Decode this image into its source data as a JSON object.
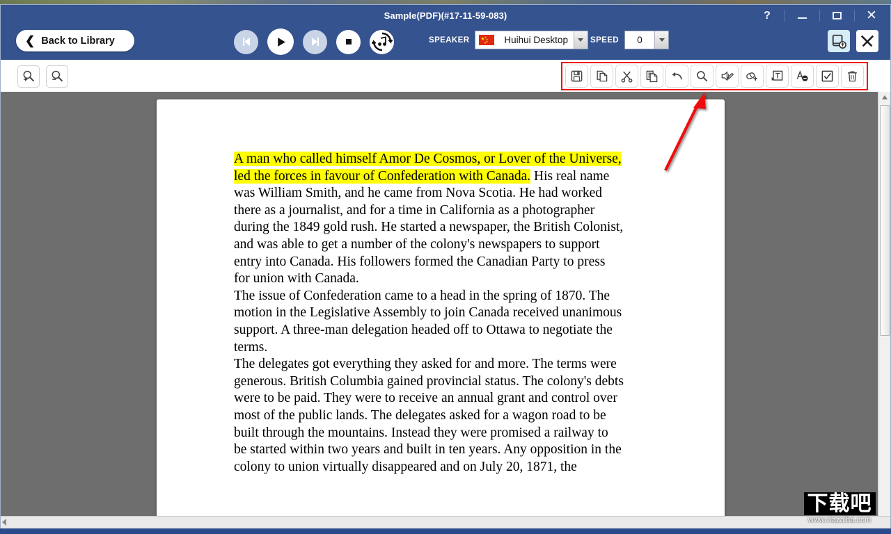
{
  "window": {
    "title": "Sample(PDF)(#17-11-59-083)",
    "controls": [
      {
        "name": "help",
        "label": "?"
      },
      {
        "name": "minimize",
        "label": "—"
      },
      {
        "name": "maximize",
        "label": "❐"
      },
      {
        "name": "close",
        "label": "✕"
      }
    ]
  },
  "toolbar": {
    "back_label": "Back to Library",
    "back_chevron": "❮",
    "transport": [
      {
        "name": "previous-button",
        "icon": "skip-back-icon",
        "state": "disabled"
      },
      {
        "name": "play-button",
        "icon": "play-icon",
        "state": "enabled"
      },
      {
        "name": "next-button",
        "icon": "skip-forward-icon",
        "state": "disabled"
      },
      {
        "name": "stop-button",
        "icon": "stop-icon",
        "state": "enabled"
      },
      {
        "name": "repeat-button",
        "icon": "repeat-music-icon",
        "state": "enabled"
      }
    ],
    "speaker_label": "SPEAKER",
    "speaker_value": "Huihui Desktop",
    "speed_label": "SPEED",
    "speed_value": "0",
    "right_buttons": [
      {
        "name": "send-to-device-button",
        "icon": "device-upload-icon",
        "selected": true
      },
      {
        "name": "settings-tools-button",
        "icon": "tools-icon",
        "selected": false
      }
    ]
  },
  "edit_toolbar": {
    "zoom_buttons": [
      {
        "name": "zoom-in-button",
        "icon": "magnifier-plus-icon"
      },
      {
        "name": "zoom-out-button",
        "icon": "magnifier-minus-icon"
      }
    ],
    "highlight_color": "#ee1111",
    "buttons": [
      {
        "name": "save-button",
        "icon": "floppy-save-icon"
      },
      {
        "name": "copy-pages-button",
        "icon": "copy-pages-icon"
      },
      {
        "name": "cut-button",
        "icon": "scissors-icon"
      },
      {
        "name": "duplicate-button",
        "icon": "document-copy-icon"
      },
      {
        "name": "undo-button",
        "icon": "undo-arrow-icon"
      },
      {
        "name": "find-button",
        "icon": "magnifier-icon"
      },
      {
        "name": "edit-pronunciation-button",
        "icon": "speaker-pencil-icon"
      },
      {
        "name": "add-highlight-button",
        "icon": "eraser-plus-icon"
      },
      {
        "name": "insert-text-button",
        "icon": "text-insert-icon"
      },
      {
        "name": "remove-annotation-button",
        "icon": "annotation-remove-icon"
      },
      {
        "name": "checkbox-button",
        "icon": "checkbox-icon"
      },
      {
        "name": "delete-button",
        "icon": "trash-icon"
      }
    ]
  },
  "document": {
    "highlight_color": "#ffff00",
    "highlighted_text": "A man who called himself Amor De Cosmos, or Lover of the Universe, led the forces in favour of Confederation with Canada.",
    "paragraphs": [
      {
        "highlight": "A man who called himself Amor De Cosmos, or Lover of the Universe, led the forces in favour of Confederation with Canada.",
        "rest": " His real name was William Smith, and he came from Nova Scotia. He had worked there as a journalist, and for a time in California as a photographer during the 1849 gold rush. He started a newspaper, the British Colonist, and was able to get a number of the colony's newspapers to support entry into Canada. His followers formed the Canadian Party to press for union with Canada."
      },
      {
        "highlight": "",
        "rest": "The issue of Confederation came to a head in the spring of 1870. The motion in the Legislative Assembly to join Canada received unanimous support. A three-man delegation headed off to Ottawa to negotiate the terms."
      },
      {
        "highlight": "",
        "rest": "The delegates got everything they asked for and more. The terms were generous. British Columbia gained provincial status. The colony's debts were to be paid. They were to receive an annual grant and control over most of the public lands. The delegates asked for a wagon road to be built through the mountains. Instead they were promised a railway to be started within two years and built in ten years. Any opposition in the colony to union virtually disappeared and on July 20, 1871, the"
      }
    ]
  },
  "annotation": {
    "arrow_color": "#ee1111",
    "arrow_from": "955,245",
    "arrow_to": "1012,133"
  },
  "watermark": {
    "text": "下载吧",
    "url": "www.xiazaiba.com"
  }
}
